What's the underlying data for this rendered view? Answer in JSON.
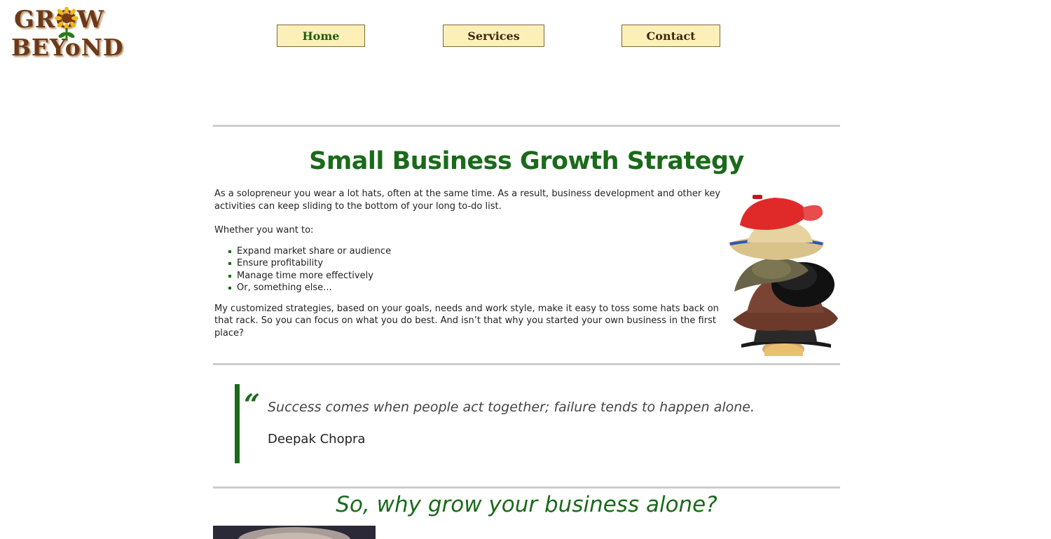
{
  "logo": {
    "line1": "GROW",
    "line2": "BEYoND"
  },
  "nav": {
    "home": "Home",
    "services": "Services",
    "contact": "Contact"
  },
  "main": {
    "title": "Small Business Growth Strategy",
    "intro": "As a solopreneur you wear a lot hats, often at the same time. As a result, business development and other key activities can keep sliding to the bottom of your long to-do list.",
    "lead": "Whether you want to:",
    "bullets": [
      "Expand market share or audience",
      "Ensure profitability",
      "Manage time more effectively",
      "Or, something else..."
    ],
    "closing": "My customized strategies, based on your goals, needs and work style, make it easy to toss some hats back on that rack. So you can focus on what you do best. And isn’t that why you started your own business in the first place?"
  },
  "quote": {
    "mark": "“",
    "text": "Success comes when people act together; failure tends to happen alone.",
    "author": "Deepak Chopra"
  },
  "section2": {
    "title": "So, why grow your business alone?"
  },
  "colors": {
    "accent": "#1a6a1a",
    "nav_bg": "#fdefb8",
    "logo_brown": "#6b3a1a",
    "rule": "#cccccc"
  }
}
